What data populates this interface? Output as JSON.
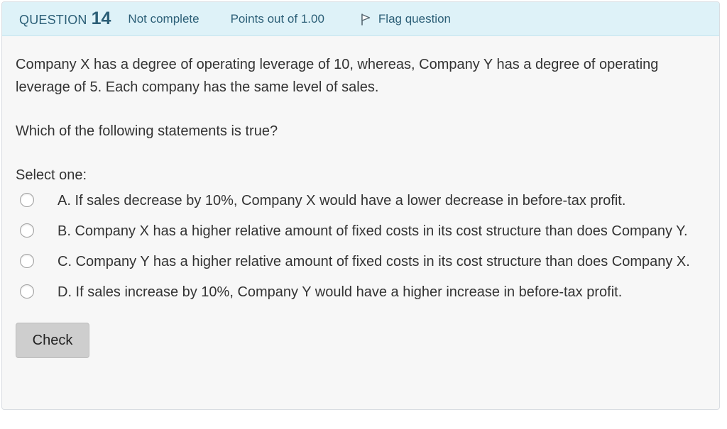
{
  "question_info": {
    "question_label": "QUESTION",
    "question_number": "14",
    "state": "Not complete",
    "grade": "Points out of 1.00",
    "flag": {
      "label": "Flag question",
      "icon": "flag-icon"
    }
  },
  "question": {
    "text_paragraphs": [
      "Company X has a degree of operating leverage of 10, whereas, Company Y has a degree of operating leverage of 5. Each company has the same level of sales.",
      "Which of the following statements is true?"
    ],
    "prompt": "Select one:",
    "options": [
      {
        "label": "A. If sales decrease by 10%, Company X would have a lower decrease in before-tax profit.",
        "selected": false
      },
      {
        "label": "B. Company X has a higher relative amount of fixed costs in its cost structure than does Company Y.",
        "selected": false
      },
      {
        "label": "C. Company Y has a higher relative amount of fixed costs in its cost structure than does Company X.",
        "selected": false
      },
      {
        "label": "D. If sales increase by 10%, Company Y would have a higher increase in before-tax profit.",
        "selected": false
      }
    ]
  },
  "check_button": "Check",
  "colors": {
    "info_background": "#def2f8",
    "info_text": "#2c5f77",
    "content_background": "#f7f7f7",
    "button_background": "#cecece"
  }
}
